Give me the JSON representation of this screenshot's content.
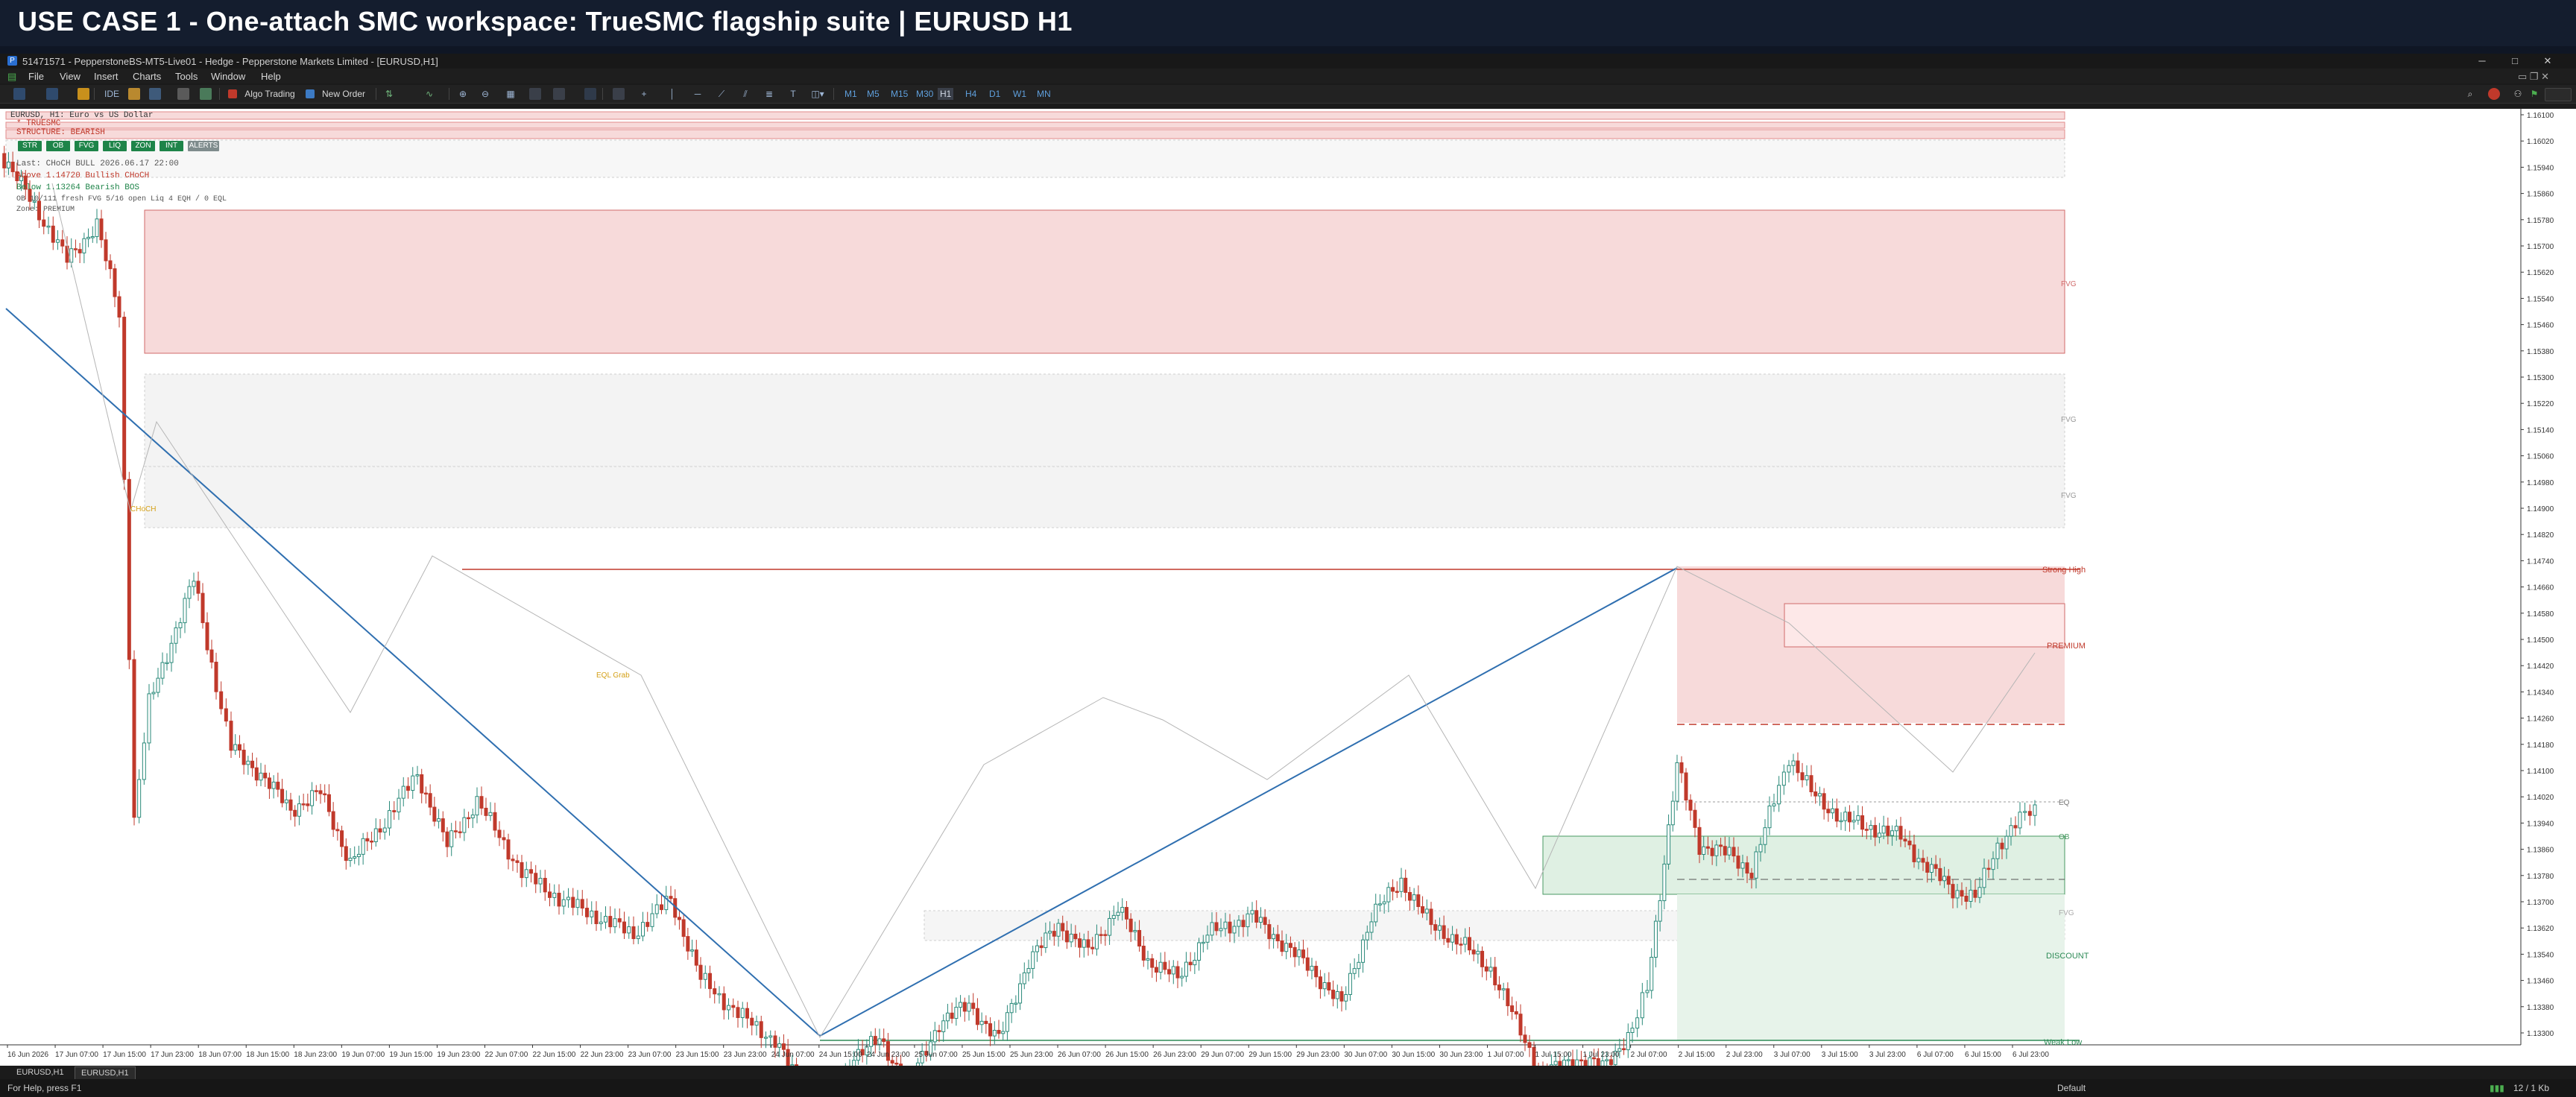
{
  "banner": {
    "text": "USE CASE 1 - One-attach SMC workspace: TrueSMC flagship suite  |  EURUSD H1"
  },
  "window": {
    "title": "51471571 - PepperstoneBS-MT5-Live01 - Hedge - Pepperstone Markets Limited - [EURUSD,H1]"
  },
  "menu": [
    "File",
    "View",
    "Insert",
    "Charts",
    "Tools",
    "Window",
    "Help"
  ],
  "toolbar": {
    "algo_trading": "Algo Trading",
    "new_order": "New Order",
    "timeframes": [
      "M1",
      "M5",
      "M15",
      "M30",
      "H1",
      "H4",
      "D1",
      "W1",
      "MN"
    ],
    "active_timeframe": "H1"
  },
  "chart": {
    "symbol_line": "EURUSD, H1: Euro vs US Dollar",
    "overlay_line2": "* TRUESMC",
    "overlay_line3": "STRUCTURE: BEARISH",
    "buttons": [
      "STR",
      "OB",
      "FVG",
      "LIQ",
      "ZON",
      "INT",
      "ALERTS"
    ],
    "info_lines": [
      "Last: CHoCH BULL  2026.06.17 22:00",
      "Above 1.14720  Bullish CHoCH",
      "Below 1.13264  Bearish BOS",
      "OB 10/111 fresh   FVG 5/16 open   Liq 4 EQH / 0 EQL",
      "Zone: PREMIUM"
    ],
    "labels": {
      "fvg_upper": "FVG",
      "fvg_mid1": "FVG",
      "fvg_mid2": "FVG",
      "strong_high": "Strong High",
      "premium": "PREMIUM",
      "eq": "EQ",
      "ob": "OB",
      "fvg_low": "FVG",
      "discount": "DISCOUNT",
      "weak_low": "Weak Low",
      "choch": "CHoCH",
      "eql": "EQL Grab"
    },
    "price_axis": [
      "1.16100",
      "1.16020",
      "1.15940",
      "1.15860",
      "1.15780",
      "1.15700",
      "1.15620",
      "1.15540",
      "1.15460",
      "1.15380",
      "1.15300",
      "1.15220",
      "1.15140",
      "1.15060",
      "1.14980",
      "1.14900",
      "1.14820",
      "1.14740",
      "1.14660",
      "1.14580",
      "1.14500",
      "1.14420",
      "1.14340",
      "1.14260",
      "1.14180",
      "1.14100",
      "1.14020",
      "1.13940",
      "1.13860",
      "1.13780",
      "1.13700",
      "1.13620",
      "1.13540",
      "1.13460",
      "1.13380",
      "1.13300"
    ],
    "time_axis": [
      "16 Jun 2026",
      "17 Jun 07:00",
      "17 Jun 15:00",
      "17 Jun 23:00",
      "18 Jun 07:00",
      "18 Jun 15:00",
      "18 Jun 23:00",
      "19 Jun 07:00",
      "19 Jun 15:00",
      "19 Jun 23:00",
      "22 Jun 07:00",
      "22 Jun 15:00",
      "22 Jun 23:00",
      "23 Jun 07:00",
      "23 Jun 15:00",
      "23 Jun 23:00",
      "24 Jun 07:00",
      "24 Jun 15:00",
      "24 Jun 23:00",
      "25 Jun 07:00",
      "25 Jun 15:00",
      "25 Jun 23:00",
      "26 Jun 07:00",
      "26 Jun 15:00",
      "26 Jun 23:00",
      "29 Jun 07:00",
      "29 Jun 15:00",
      "29 Jun 23:00",
      "30 Jun 07:00",
      "30 Jun 15:00",
      "30 Jun 23:00",
      "1 Jul 07:00",
      "1 Jul 15:00",
      "1 Jul 23:00",
      "2 Jul 07:00",
      "2 Jul 15:00",
      "2 Jul 23:00",
      "3 Jul 07:00",
      "3 Jul 15:00",
      "3 Jul 23:00",
      "6 Jul 07:00",
      "6 Jul 15:00",
      "6 Jul 23:00"
    ]
  },
  "tabs": [
    "EURUSD,H1",
    "EURUSD,H1"
  ],
  "status": {
    "help": "For Help, press F1",
    "profile": "Default",
    "traffic": "12 / 1 Kb"
  },
  "colors": {
    "bull": "#2a8a7a",
    "bear": "#c0392b",
    "premium": "#f7dada",
    "discount": "#e7f3ea",
    "trendline": "#2f6fb0",
    "gray_zone": "#f3f3f3"
  }
}
